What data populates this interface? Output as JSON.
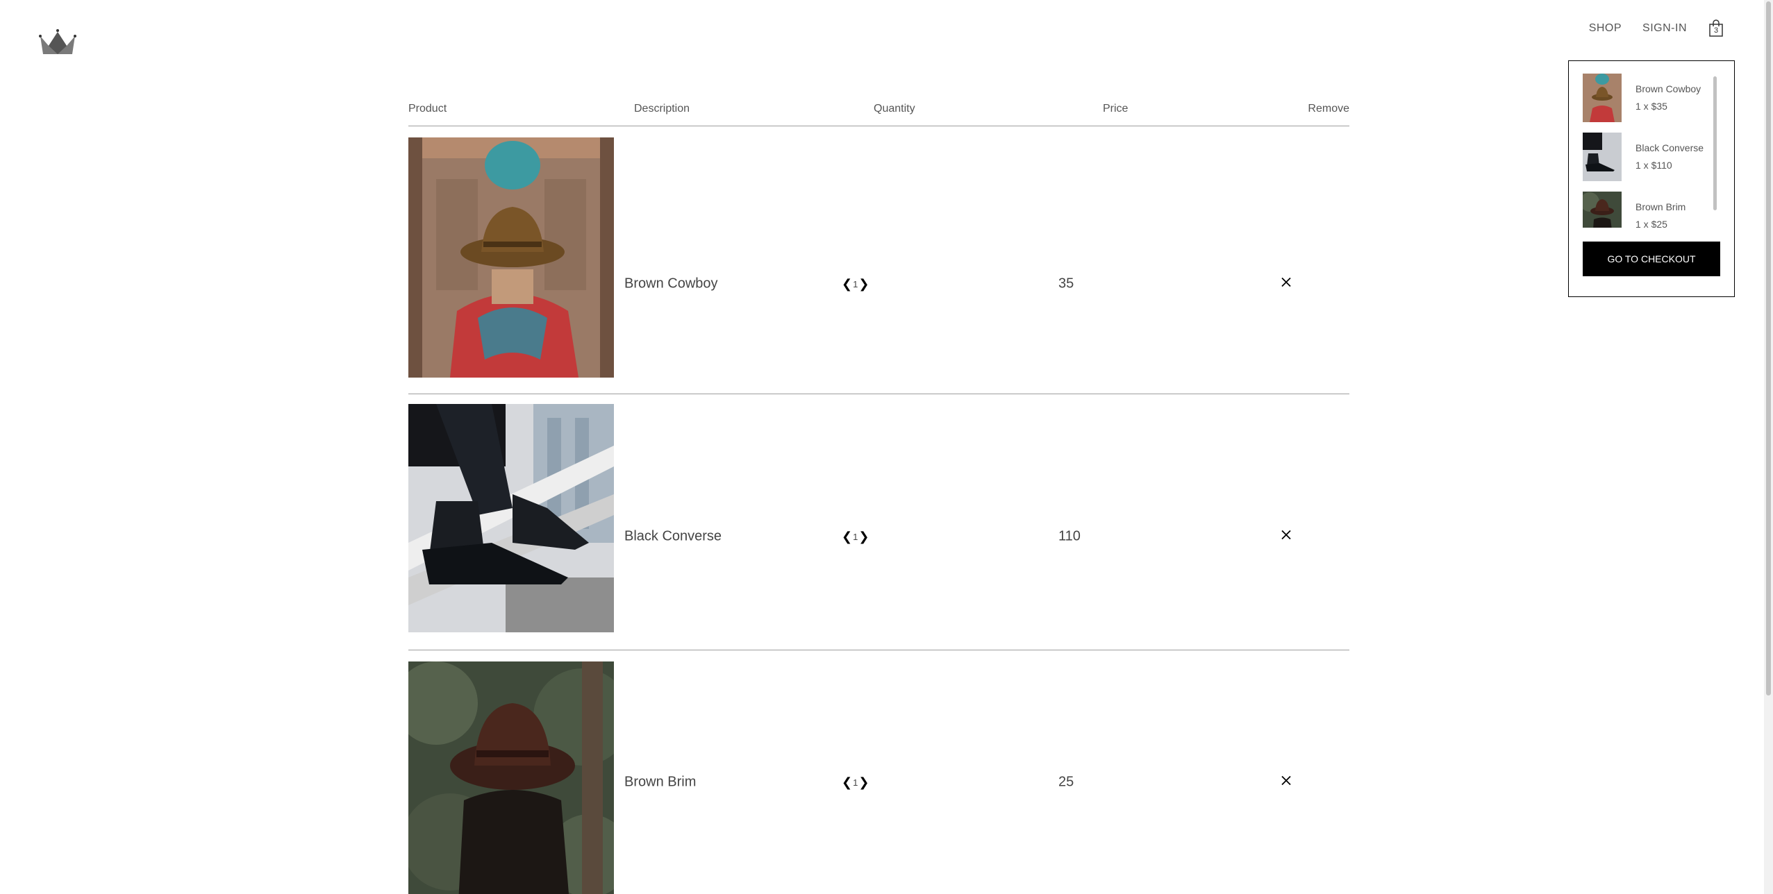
{
  "header": {
    "logo_icon": "crown-icon",
    "nav": {
      "shop": "SHOP",
      "sign_in": "SIGN-IN"
    },
    "bag_icon": "shopping-bag-icon",
    "bag_count": "3"
  },
  "table": {
    "headers": {
      "product": "Product",
      "description": "Description",
      "quantity": "Quantity",
      "price": "Price",
      "remove": "Remove"
    },
    "rows": [
      {
        "name": "Brown Cowboy",
        "quantity": "1",
        "price": "35"
      },
      {
        "name": "Black Converse",
        "quantity": "1",
        "price": "110"
      },
      {
        "name": "Brown Brim",
        "quantity": "1",
        "price": "25"
      }
    ],
    "decrease_icon": "chevron-left-icon",
    "increase_icon": "chevron-right-icon",
    "remove_icon": "close-icon"
  },
  "cart_dropdown": {
    "items": [
      {
        "name": "Brown Cowboy",
        "detail": "1 x $35"
      },
      {
        "name": "Black Converse",
        "detail": "1 x $110"
      },
      {
        "name": "Brown Brim",
        "detail": "1 x $25"
      }
    ],
    "checkout_label": "GO TO CHECKOUT"
  }
}
